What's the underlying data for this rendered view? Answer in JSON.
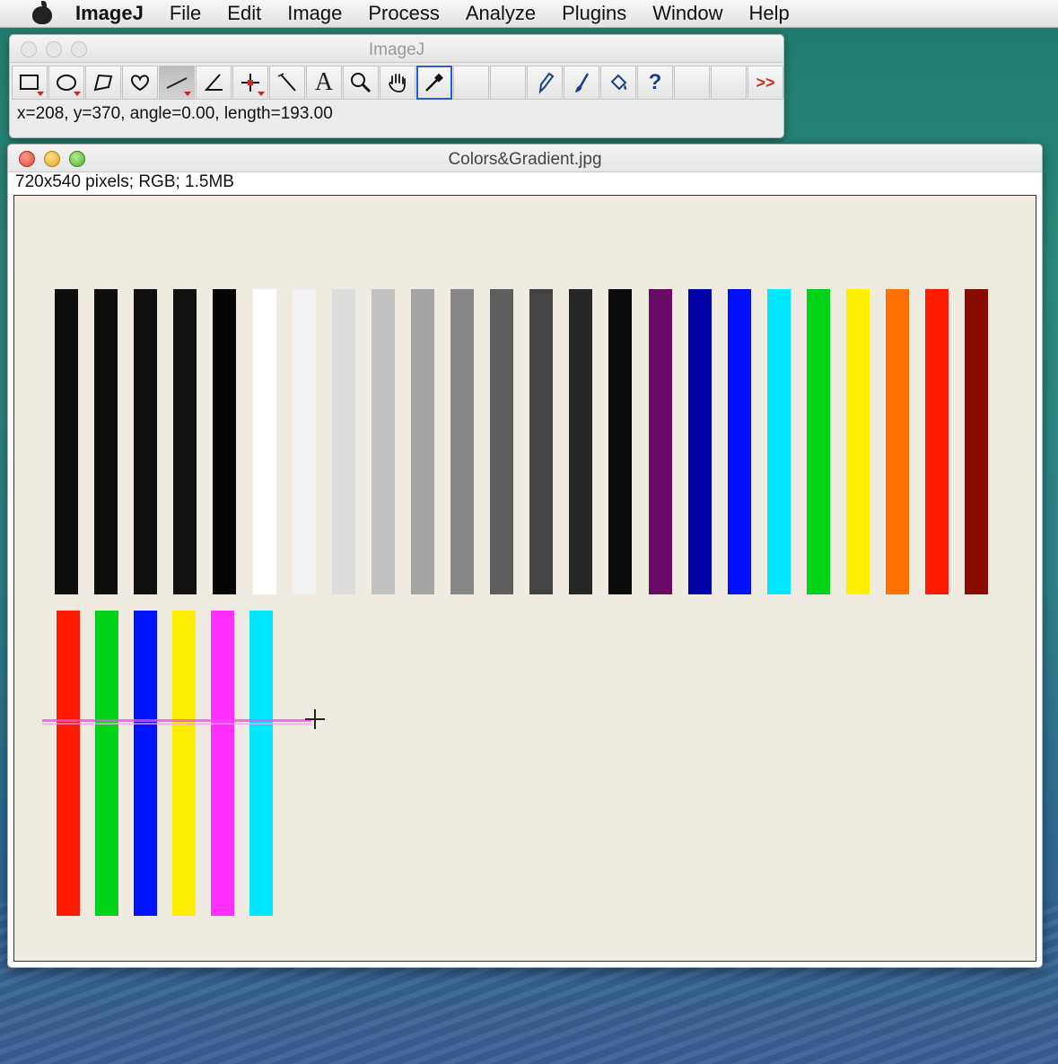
{
  "menubar": {
    "items": [
      "ImageJ",
      "File",
      "Edit",
      "Image",
      "Process",
      "Analyze",
      "Plugins",
      "Window",
      "Help"
    ]
  },
  "toolbar_window": {
    "title": "ImageJ",
    "status": "x=208, y=370, angle=0.00, length=193.00",
    "more_label": ">>",
    "help_label": "?",
    "text_tool_label": "A"
  },
  "image_window": {
    "title": "Colors&Gradient.jpg",
    "info": "720x540 pixels; RGB; 1.5MB"
  },
  "canvas": {
    "background": "#efebe0",
    "top_row_colors": [
      "#0e0e0e",
      "#0e0e0e",
      "#101010",
      "#121212",
      "#050505",
      "#ffffff",
      "#f3f3f3",
      "#dcdcdc",
      "#c2c2c2",
      "#a4a4a4",
      "#878787",
      "#5e5e5e",
      "#444444",
      "#262626",
      "#0b0b0b",
      "#6b0a64",
      "#0000a8",
      "#0010ff",
      "#00e8ff",
      "#00d21a",
      "#ffee00",
      "#ff7000",
      "#ff1a00",
      "#8a0a00"
    ],
    "bottom_row_colors": [
      "#ff1a00",
      "#00d21a",
      "#0014ff",
      "#ffee00",
      "#ff30ff",
      "#00e8ff"
    ]
  }
}
